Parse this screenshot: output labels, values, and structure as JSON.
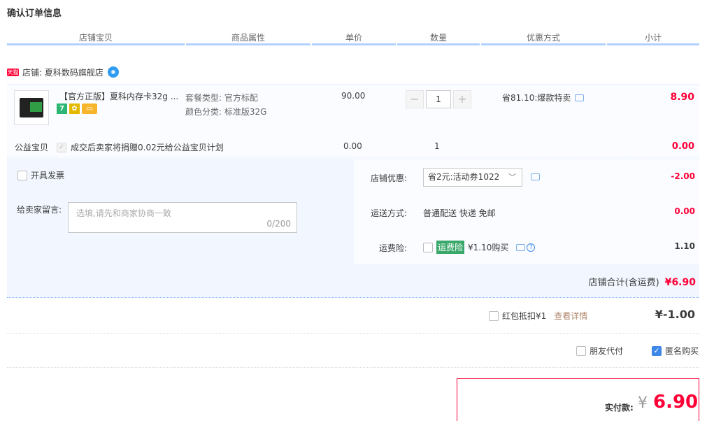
{
  "page_title": "确认订单信息",
  "columns": [
    "店铺宝贝",
    "商品属性",
    "单价",
    "数量",
    "优惠方式",
    "小计"
  ],
  "shop": {
    "tag": "天猫",
    "label": "店铺: 夏科数码旗舰店"
  },
  "item": {
    "title": "【官方正版】夏科内存卡32g ...",
    "props": [
      "套餐类型: 官方标配",
      "颜色分类: 标准版32G"
    ],
    "price": "90.00",
    "qty": "1",
    "promo": "省81.10:爆款特卖",
    "subtotal": "8.90",
    "badge_7": "7"
  },
  "charity": {
    "label": "公益宝贝",
    "text": "成交后卖家将捐赠0.02元给公益宝贝计划",
    "price": "0.00",
    "qty": "1",
    "subtotal": "0.00"
  },
  "invoice_label": "开具发票",
  "message": {
    "label": "给卖家留言:",
    "placeholder": "选填,请先和商家协商一致",
    "count": "0/200"
  },
  "shop_discount": {
    "label": "店铺优惠:",
    "selected": "省2元:活动券1022",
    "amount": "-2.00"
  },
  "shipping": {
    "label": "运送方式:",
    "value": "普通配送 快递 免邮",
    "amount": "0.00"
  },
  "insurance": {
    "label": "运费险:",
    "tag": "运费险",
    "value": "¥1.10购买",
    "amount": "1.10"
  },
  "shop_total": {
    "label": "店铺合计(含运费)",
    "amount": "¥6.90"
  },
  "red_packet": {
    "label": "红包抵扣¥1",
    "link": "查看详情",
    "amount": "¥-1.00"
  },
  "friend_pay": "朋友代付",
  "anonymous": "匿名购买",
  "pay": {
    "label": "实付款:",
    "yen": "¥",
    "amount": "6.90"
  }
}
